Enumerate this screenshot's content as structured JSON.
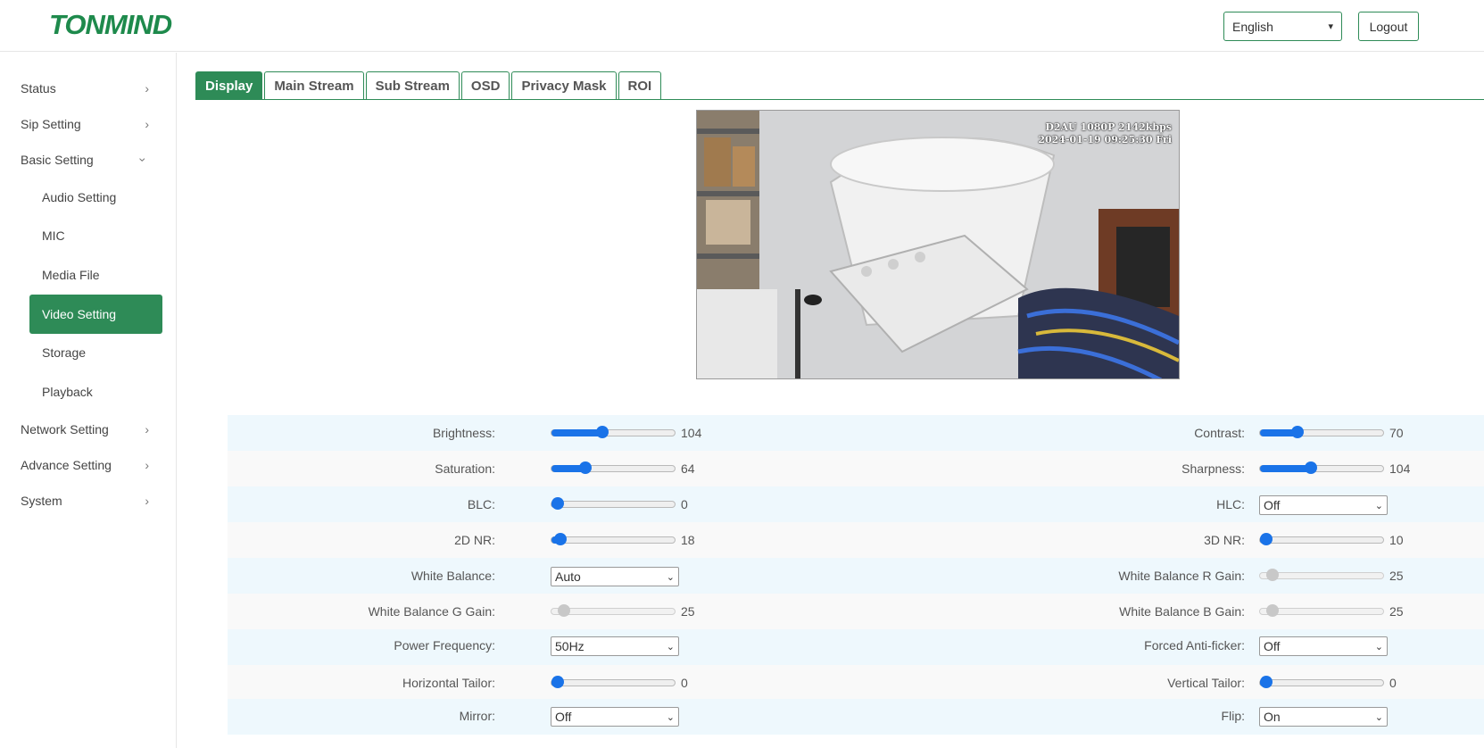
{
  "header": {
    "logo": "TONMIND",
    "language": "English",
    "logout_label": "Logout"
  },
  "sidebar": {
    "items": [
      {
        "label": "Status",
        "chevron": ">"
      },
      {
        "label": "Sip Setting",
        "chevron": ">"
      },
      {
        "label": "Basic Setting",
        "chevron": "v"
      },
      {
        "label": "Network Setting",
        "chevron": ">"
      },
      {
        "label": "Advance Setting",
        "chevron": ">"
      },
      {
        "label": "System",
        "chevron": ">"
      }
    ],
    "basic_setting_children": [
      "Audio Setting",
      "MIC",
      "Media File",
      "Video Setting",
      "Storage",
      "Playback"
    ],
    "active_child": "Video Setting"
  },
  "tabs": [
    "Display",
    "Main Stream",
    "Sub Stream",
    "OSD",
    "Privacy Mask",
    "ROI"
  ],
  "active_tab": "Display",
  "video": {
    "osd_line1": "D2AU 1080P 2142kbps",
    "osd_line2": "2024-01-19 09:25:30 Fri"
  },
  "settings": {
    "brightness": {
      "label": "Brightness:",
      "value": "104",
      "fraction": 0.41
    },
    "contrast": {
      "label": "Contrast:",
      "value": "70",
      "fraction": 0.3
    },
    "saturation": {
      "label": "Saturation:",
      "value": "64",
      "fraction": 0.27
    },
    "sharpness": {
      "label": "Sharpness:",
      "value": "104",
      "fraction": 0.41
    },
    "blc": {
      "label": "BLC:",
      "value": "0",
      "fraction": 0.0
    },
    "hlc": {
      "label": "HLC:",
      "value": "Off"
    },
    "nr2d": {
      "label": "2D NR:",
      "value": "18",
      "fraction": 0.07
    },
    "nr3d": {
      "label": "3D NR:",
      "value": "10",
      "fraction": 0.04
    },
    "white_balance": {
      "label": "White Balance:",
      "value": "Auto"
    },
    "wb_r_gain": {
      "label": "White Balance R Gain:",
      "value": "25",
      "fraction": 0.1
    },
    "wb_g_gain": {
      "label": "White Balance G Gain:",
      "value": "25",
      "fraction": 0.1
    },
    "wb_b_gain": {
      "label": "White Balance B Gain:",
      "value": "25",
      "fraction": 0.1
    },
    "power_frequency": {
      "label": "Power Frequency:",
      "value": "50Hz"
    },
    "forced_anti_flicker": {
      "label": "Forced Anti-ficker:",
      "value": "Off"
    },
    "horizontal_tailor": {
      "label": "Horizontal Tailor:",
      "value": "0",
      "fraction": 0.0
    },
    "vertical_tailor": {
      "label": "Vertical Tailor:",
      "value": "0",
      "fraction": 0.0
    },
    "mirror": {
      "label": "Mirror:",
      "value": "Off"
    },
    "flip": {
      "label": "Flip:",
      "value": "On"
    }
  },
  "colors": {
    "accent": "#2e8b57",
    "slider": "#1a73e8",
    "row_odd": "#eef8fd",
    "row_even": "#f9f9f9"
  }
}
